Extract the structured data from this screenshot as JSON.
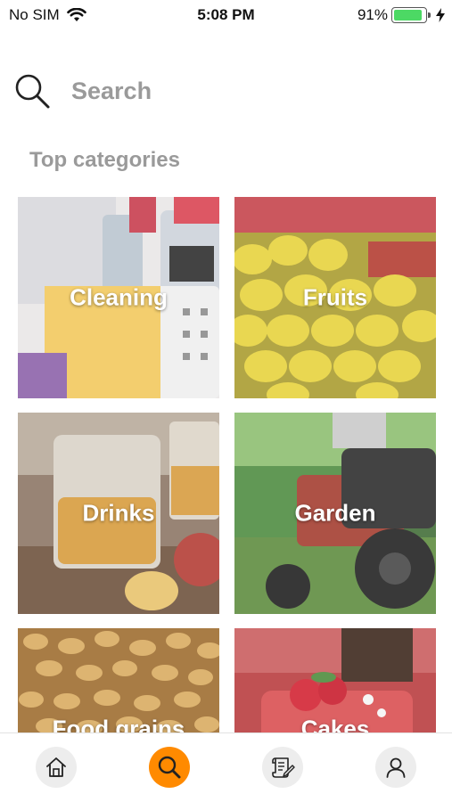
{
  "status_bar": {
    "carrier": "No SIM",
    "time": "5:08 PM",
    "battery_percent": "91%",
    "battery_level": 0.91
  },
  "search": {
    "placeholder": "Search"
  },
  "section": {
    "title": "Top categories"
  },
  "categories": [
    {
      "label": "Cleaning"
    },
    {
      "label": "Fruits"
    },
    {
      "label": "Drinks"
    },
    {
      "label": "Garden"
    },
    {
      "label": "Food grains"
    },
    {
      "label": "Cakes"
    }
  ],
  "tab_bar": {
    "items": [
      {
        "icon": "home-icon"
      },
      {
        "icon": "search-icon"
      },
      {
        "icon": "orders-icon"
      },
      {
        "icon": "account-icon"
      }
    ],
    "active_index": 1
  },
  "colors": {
    "accent": "#ff8a00",
    "battery": "#4cd964",
    "muted_text": "#9a9a9a"
  }
}
